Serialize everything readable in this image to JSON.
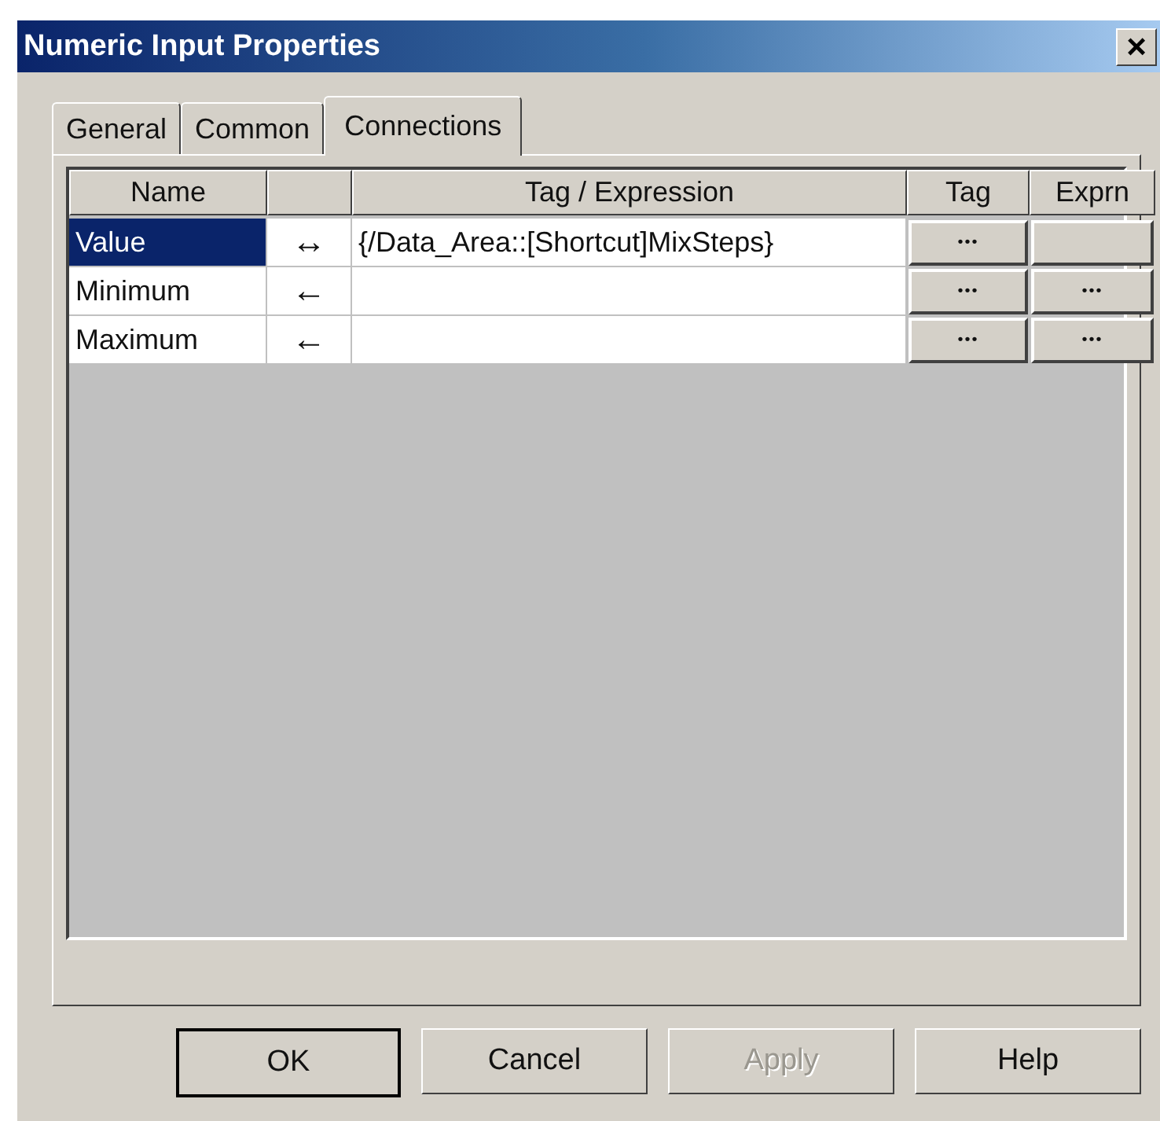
{
  "window": {
    "title": "Numeric Input Properties",
    "close": "×"
  },
  "tabs": [
    {
      "label": "General",
      "selected": false
    },
    {
      "label": "Common",
      "selected": false
    },
    {
      "label": "Connections",
      "selected": true
    }
  ],
  "table": {
    "columns": [
      "Name",
      "",
      "Tag / Expression",
      "Tag",
      "Exprn"
    ],
    "rows": [
      {
        "name": "Value",
        "direction": "↔",
        "expression": "{/Data_Area::[Shortcut]MixSteps}",
        "tag_button": "•••",
        "exprn_button": "",
        "selected": true
      },
      {
        "name": "Minimum",
        "direction": "←",
        "expression": "",
        "tag_button": "•••",
        "exprn_button": "•••",
        "selected": false
      },
      {
        "name": "Maximum",
        "direction": "←",
        "expression": "",
        "tag_button": "•••",
        "exprn_button": "•••",
        "selected": false
      }
    ]
  },
  "buttons": [
    {
      "label": "OK",
      "disabled": false,
      "default": true
    },
    {
      "label": "Cancel",
      "disabled": false,
      "default": false
    },
    {
      "label": "Apply",
      "disabled": true,
      "default": false
    },
    {
      "label": "Help",
      "disabled": false,
      "default": false
    }
  ]
}
